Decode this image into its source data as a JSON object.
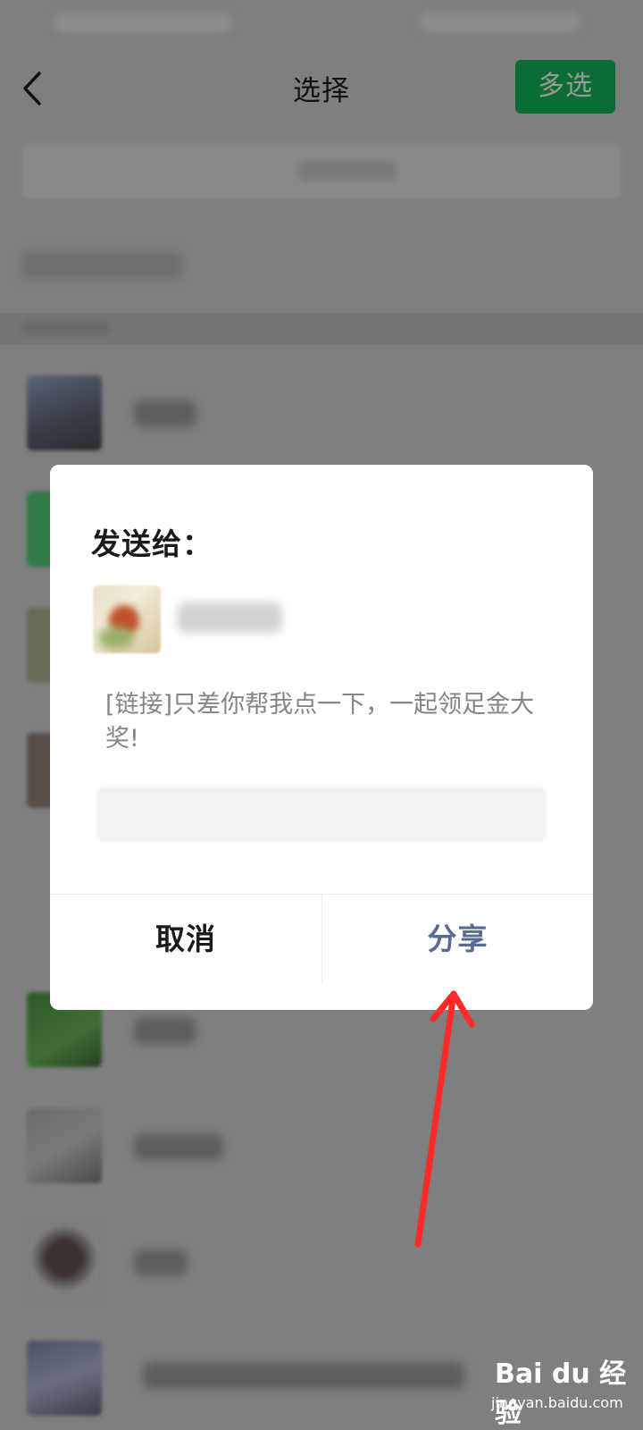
{
  "topbar": {
    "title": "选择",
    "multi_select_label": "多选"
  },
  "dialog": {
    "title": "发送给：",
    "message": "[链接]只差你帮我点一下，一起领足金大奖!",
    "cancel_label": "取消",
    "share_label": "分享"
  },
  "watermark": {
    "brand": "Bai du 经验",
    "url": "jingyan.baidu.com"
  },
  "colors": {
    "accent_green": "#0a6d34",
    "link_blue": "#576b95",
    "annotation_red": "#ff2a2a",
    "overlay": "#7f7f7f"
  }
}
